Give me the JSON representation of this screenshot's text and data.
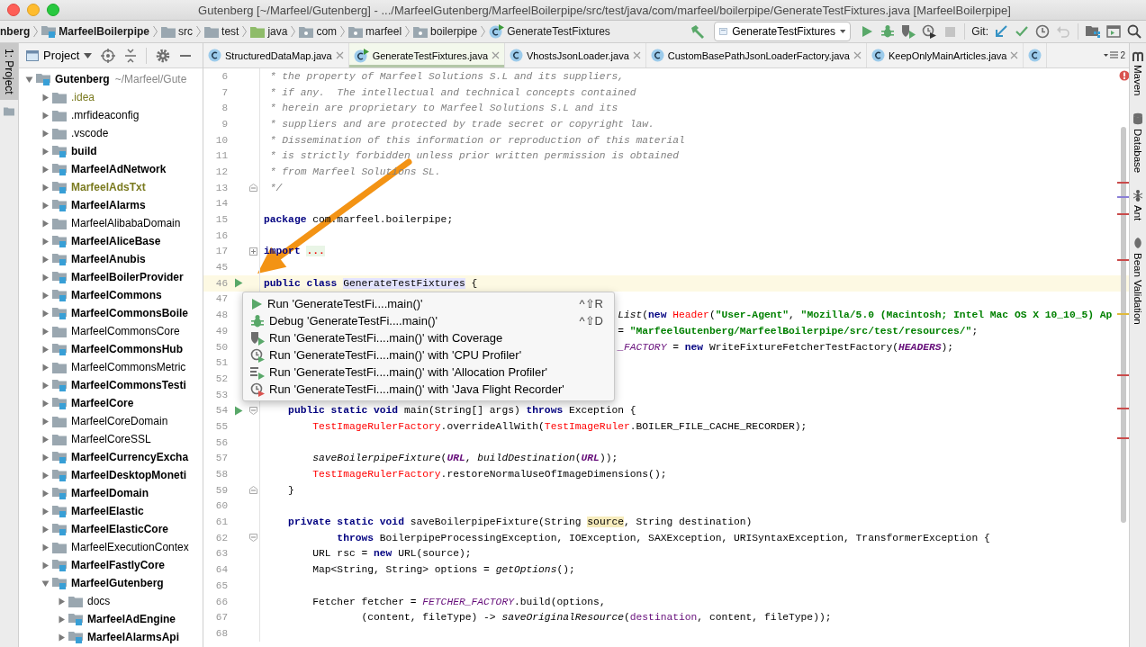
{
  "window": {
    "title": "Gutenberg [~/Marfeel/Gutenberg] - .../MarfeelGutenberg/MarfeelBoilerpipe/src/test/java/com/marfeel/boilerpipe/GenerateTestFixtures.java [MarfeelBoilerpipe]"
  },
  "breadcrumbs": [
    {
      "label": "nberg",
      "kind": "text"
    },
    {
      "label": "MarfeelBoilerpipe",
      "kind": "module"
    },
    {
      "label": "src",
      "kind": "folder"
    },
    {
      "label": "test",
      "kind": "folder"
    },
    {
      "label": "java",
      "kind": "source"
    },
    {
      "label": "com",
      "kind": "package"
    },
    {
      "label": "marfeel",
      "kind": "package"
    },
    {
      "label": "boilerpipe",
      "kind": "package"
    },
    {
      "label": "GenerateTestFixtures",
      "kind": "run-class"
    }
  ],
  "toolbar": {
    "build_buttons": [
      {
        "kind": "build",
        "disabled": false
      }
    ],
    "run_config": "GenerateTestFixtures",
    "run_buttons": [
      {
        "kind": "run",
        "disabled": false
      },
      {
        "kind": "debug",
        "disabled": false
      },
      {
        "kind": "coverage",
        "disabled": false
      },
      {
        "kind": "profile",
        "disabled": false
      },
      {
        "kind": "stop",
        "disabled": true
      }
    ],
    "git_label": "Git:",
    "git_buttons": [
      {
        "kind": "update",
        "disabled": false
      },
      {
        "kind": "commit",
        "disabled": false
      },
      {
        "kind": "history",
        "disabled": false
      },
      {
        "kind": "rollback",
        "disabled": true
      }
    ],
    "tool_buttons": [
      {
        "kind": "structure",
        "disabled": false
      },
      {
        "kind": "terminal",
        "disabled": false
      },
      {
        "kind": "search",
        "disabled": false
      }
    ]
  },
  "left_tools": [
    {
      "label": "1: Project",
      "selected": true
    }
  ],
  "project": {
    "view": "Project",
    "tree": [
      {
        "label": "Gutenberg",
        "hint": "~/Marfeel/Gute",
        "module": true,
        "expanded": true,
        "ignored": false,
        "children": [
          {
            "label": ".idea",
            "module": false,
            "expanded": false,
            "ignored": true
          },
          {
            "label": ".mrfideaconfig",
            "module": false,
            "expanded": false,
            "ignored": false
          },
          {
            "label": ".vscode",
            "module": false,
            "expanded": false,
            "ignored": false
          },
          {
            "label": "build",
            "module": true,
            "expanded": false,
            "ignored": false
          },
          {
            "label": "MarfeelAdNetwork",
            "module": true,
            "expanded": false,
            "ignored": false
          },
          {
            "label": "MarfeelAdsTxt",
            "module": true,
            "expanded": false,
            "ignored": true
          },
          {
            "label": "MarfeelAlarms",
            "module": true,
            "expanded": false,
            "ignored": false
          },
          {
            "label": "MarfeelAlibabaDomain",
            "module": false,
            "expanded": false,
            "ignored": false
          },
          {
            "label": "MarfeelAliceBase",
            "module": true,
            "expanded": false,
            "ignored": false
          },
          {
            "label": "MarfeelAnubis",
            "module": true,
            "expanded": false,
            "ignored": false
          },
          {
            "label": "MarfeelBoilerProvider",
            "module": true,
            "expanded": false,
            "ignored": false
          },
          {
            "label": "MarfeelCommons",
            "module": true,
            "expanded": false,
            "ignored": false
          },
          {
            "label": "MarfeelCommonsBoile",
            "module": true,
            "expanded": false,
            "ignored": false
          },
          {
            "label": "MarfeelCommonsCore",
            "module": false,
            "expanded": false,
            "ignored": false
          },
          {
            "label": "MarfeelCommonsHub",
            "module": true,
            "expanded": false,
            "ignored": false
          },
          {
            "label": "MarfeelCommonsMetric",
            "module": false,
            "expanded": false,
            "ignored": false
          },
          {
            "label": "MarfeelCommonsTesti",
            "module": true,
            "expanded": false,
            "ignored": false
          },
          {
            "label": "MarfeelCore",
            "module": true,
            "expanded": false,
            "ignored": false
          },
          {
            "label": "MarfeelCoreDomain",
            "module": false,
            "expanded": false,
            "ignored": false
          },
          {
            "label": "MarfeelCoreSSL",
            "module": false,
            "expanded": false,
            "ignored": false
          },
          {
            "label": "MarfeelCurrencyExcha",
            "module": true,
            "expanded": false,
            "ignored": false
          },
          {
            "label": "MarfeelDesktopMoneti",
            "module": true,
            "expanded": false,
            "ignored": false
          },
          {
            "label": "MarfeelDomain",
            "module": true,
            "expanded": false,
            "ignored": false
          },
          {
            "label": "MarfeelElastic",
            "module": true,
            "expanded": false,
            "ignored": false
          },
          {
            "label": "MarfeelElasticCore",
            "module": true,
            "expanded": false,
            "ignored": false
          },
          {
            "label": "MarfeelExecutionContex",
            "module": false,
            "expanded": false,
            "ignored": false
          },
          {
            "label": "MarfeelFastlyCore",
            "module": true,
            "expanded": false,
            "ignored": false
          },
          {
            "label": "MarfeelGutenberg",
            "module": true,
            "expanded": true,
            "ignored": false,
            "children": [
              {
                "label": "docs",
                "module": false,
                "expanded": false,
                "ignored": false
              },
              {
                "label": "MarfeelAdEngine",
                "module": true,
                "expanded": false,
                "ignored": false
              },
              {
                "label": "MarfeelAlarmsApi",
                "module": true,
                "expanded": false,
                "ignored": false
              }
            ]
          }
        ]
      }
    ]
  },
  "editor": {
    "tabs": [
      {
        "label": "StructuredDataMap.java",
        "kind": "class",
        "selected": false
      },
      {
        "label": "GenerateTestFixtures.java",
        "kind": "run-class",
        "selected": true
      },
      {
        "label": "VhostsJsonLoader.java",
        "kind": "class",
        "selected": false
      },
      {
        "label": "CustomBasePathJsonLoaderFactory.java",
        "kind": "class",
        "selected": false
      },
      {
        "label": "KeepOnlyMainArticles.java",
        "kind": "class",
        "selected": false
      },
      {
        "kind": "class",
        "selected": false
      }
    ],
    "tab_overflow": "2",
    "lines": [
      {
        "n": "6",
        "kind": "code",
        "current": false,
        "tokens": [
          {
            "kind": "cm",
            "text": " * the property of Marfeel Solutions S.L and its suppliers,"
          }
        ]
      },
      {
        "n": "7",
        "kind": "code",
        "current": false,
        "tokens": [
          {
            "kind": "cm",
            "text": " * if any.  The intellectual and technical concepts contained"
          }
        ]
      },
      {
        "n": "8",
        "kind": "code",
        "current": false,
        "tokens": [
          {
            "kind": "cm",
            "text": " * herein are proprietary to Marfeel Solutions S.L and its"
          }
        ]
      },
      {
        "n": "9",
        "kind": "code",
        "current": false,
        "tokens": [
          {
            "kind": "cm",
            "text": " * suppliers and are protected by trade secret or copyright law."
          }
        ]
      },
      {
        "n": "10",
        "kind": "code",
        "current": false,
        "tokens": [
          {
            "kind": "cm",
            "text": " * Dissemination of this information or reproduction of this material"
          }
        ]
      },
      {
        "n": "11",
        "kind": "code",
        "current": false,
        "tokens": [
          {
            "kind": "cm",
            "text": " * is strictly forbidden unless prior written permission is obtained"
          }
        ]
      },
      {
        "n": "12",
        "kind": "code",
        "current": false,
        "tokens": [
          {
            "kind": "cm",
            "text": " * from Marfeel Solutions SL."
          }
        ]
      },
      {
        "n": "13",
        "kind": "fold-end",
        "current": false,
        "tokens": [
          {
            "kind": "cm",
            "text": " */"
          }
        ]
      },
      {
        "n": "14",
        "kind": "code",
        "current": false
      },
      {
        "n": "15",
        "kind": "code",
        "current": false,
        "tokens": [
          {
            "kind": "kw",
            "text": "package"
          },
          {
            "kind": "plain",
            "text": " com.marfeel.boilerpipe;"
          }
        ]
      },
      {
        "n": "16",
        "kind": "code",
        "current": false
      },
      {
        "n": "17",
        "kind": "fold-collapsed",
        "current": false,
        "tokens": [
          {
            "kind": "kw",
            "text": "import "
          },
          {
            "kind": "folded",
            "text": "..."
          }
        ]
      },
      {
        "n": "45",
        "kind": "code",
        "current": false
      },
      {
        "n": "46",
        "kind": "run",
        "current": true,
        "tokens": [
          {
            "kind": "kw",
            "text": "public class "
          },
          {
            "kind": "decl",
            "text": "GenerateTestFixtures"
          },
          {
            "kind": "plain",
            "text": " {"
          }
        ]
      },
      {
        "n": "47",
        "kind": "code",
        "current": false
      },
      {
        "n": "48",
        "kind": "covered",
        "current": false,
        "tokens": [
          {
            "kind": "call",
            "text": "List"
          },
          {
            "kind": "plain",
            "text": "("
          },
          {
            "kind": "kw",
            "text": "new "
          },
          {
            "kind": "err",
            "text": "Header"
          },
          {
            "kind": "plain",
            "text": "("
          },
          {
            "kind": "str",
            "text": "\"User-Agent\""
          },
          {
            "kind": "plain",
            "text": ", "
          },
          {
            "kind": "str",
            "text": "\"Mozilla/5.0 (Macintosh; Intel Mac OS X 10_10_5) Ap"
          }
        ]
      },
      {
        "n": "49",
        "kind": "covered",
        "current": false,
        "tokens": [
          {
            "kind": "plain",
            "text": "= "
          },
          {
            "kind": "str",
            "text": "\"MarfeelGutenberg/MarfeelBoilerpipe/src/test/resources/\""
          },
          {
            "kind": "plain",
            "text": ";"
          }
        ]
      },
      {
        "n": "50",
        "kind": "covered",
        "current": false,
        "tokens": [
          {
            "kind": "static",
            "text": "_FACTORY"
          },
          {
            "kind": "plain",
            "text": " = "
          },
          {
            "kind": "kw",
            "text": "new"
          },
          {
            "kind": "plain",
            "text": " WriteFixtureFetcherTestFactory("
          },
          {
            "kind": "const",
            "text": "HEADERS"
          },
          {
            "kind": "plain",
            "text": ");"
          }
        ]
      },
      {
        "n": "51",
        "kind": "code",
        "current": false
      },
      {
        "n": "52",
        "kind": "code",
        "current": false
      },
      {
        "n": "53",
        "kind": "code",
        "current": false
      },
      {
        "n": "54",
        "kind": "run-fold-start",
        "current": false,
        "tokens": [
          {
            "kind": "kw",
            "text": "    public static void"
          },
          {
            "kind": "plain",
            "text": " main(String[] args) "
          },
          {
            "kind": "kw",
            "text": "throws"
          },
          {
            "kind": "plain",
            "text": " Exception {"
          }
        ]
      },
      {
        "n": "55",
        "kind": "code",
        "current": false,
        "tokens": [
          {
            "kind": "err",
            "text": "        TestImageRulerFactory"
          },
          {
            "kind": "plain",
            "text": ".overrideAllWith("
          },
          {
            "kind": "err",
            "text": "TestImageRuler"
          },
          {
            "kind": "plain",
            "text": ".BOILER_FILE_CACHE_RECORDER);"
          }
        ]
      },
      {
        "n": "56",
        "kind": "code",
        "current": false
      },
      {
        "n": "57",
        "kind": "code",
        "current": false,
        "tokens": [
          {
            "kind": "call",
            "text": "        saveBoilerpipeFixture"
          },
          {
            "kind": "plain",
            "text": "("
          },
          {
            "kind": "const",
            "text": "URL"
          },
          {
            "kind": "plain",
            "text": ", "
          },
          {
            "kind": "call",
            "text": "buildDestination"
          },
          {
            "kind": "plain",
            "text": "("
          },
          {
            "kind": "const",
            "text": "URL"
          },
          {
            "kind": "plain",
            "text": "));"
          }
        ]
      },
      {
        "n": "58",
        "kind": "code",
        "current": false,
        "tokens": [
          {
            "kind": "err",
            "text": "        TestImageRulerFactory"
          },
          {
            "kind": "plain",
            "text": ".restoreNormalUseOfImageDimensions();"
          }
        ]
      },
      {
        "n": "59",
        "kind": "fold-end",
        "current": false,
        "tokens": [
          {
            "kind": "plain",
            "text": "    }"
          }
        ]
      },
      {
        "n": "60",
        "kind": "code",
        "current": false
      },
      {
        "n": "61",
        "kind": "code",
        "current": false,
        "tokens": [
          {
            "kind": "kw",
            "text": "    private static void"
          },
          {
            "kind": "plain",
            "text": " saveBoilerpipeFixture(String "
          },
          {
            "kind": "hl",
            "text": "source"
          },
          {
            "kind": "plain",
            "text": ", String destination)"
          }
        ]
      },
      {
        "n": "62",
        "kind": "fold-start",
        "current": false,
        "tokens": [
          {
            "kind": "kw",
            "text": "            throws"
          },
          {
            "kind": "plain",
            "text": " BoilerpipeProcessingException, IOException, SAXException, URISyntaxException, TransformerException {"
          }
        ]
      },
      {
        "n": "63",
        "kind": "code",
        "current": false,
        "tokens": [
          {
            "kind": "plain",
            "text": "        URL rsc = "
          },
          {
            "kind": "kw",
            "text": "new"
          },
          {
            "kind": "plain",
            "text": " URL(source);"
          }
        ]
      },
      {
        "n": "64",
        "kind": "code",
        "current": false,
        "tokens": [
          {
            "kind": "plain",
            "text": "        Map<String, String> options = "
          },
          {
            "kind": "call",
            "text": "getOptions"
          },
          {
            "kind": "plain",
            "text": "();"
          }
        ]
      },
      {
        "n": "65",
        "kind": "code",
        "current": false
      },
      {
        "n": "66",
        "kind": "code",
        "current": false,
        "tokens": [
          {
            "kind": "plain",
            "text": "        Fetcher fetcher = "
          },
          {
            "kind": "static",
            "text": "FETCHER_FACTORY"
          },
          {
            "kind": "plain",
            "text": ".build(options,"
          }
        ]
      },
      {
        "n": "67",
        "kind": "code",
        "current": false,
        "tokens": [
          {
            "kind": "plain",
            "text": "                (content, fileType) -> "
          },
          {
            "kind": "call",
            "text": "saveOriginalResource"
          },
          {
            "kind": "plain",
            "text": "("
          },
          {
            "kind": "param",
            "text": "destination"
          },
          {
            "kind": "plain",
            "text": ", content, fileType));"
          }
        ]
      },
      {
        "n": "68",
        "kind": "code",
        "current": false
      }
    ],
    "run_menu": [
      {
        "kind": "run",
        "label": "Run 'GenerateTestFi....main()'",
        "shortcut": "^⇧R"
      },
      {
        "kind": "debug",
        "label": "Debug 'GenerateTestFi....main()'",
        "shortcut": "^⇧D"
      },
      {
        "kind": "coverage",
        "label": "Run 'GenerateTestFi....main()' with Coverage"
      },
      {
        "kind": "cpu",
        "label": "Run 'GenerateTestFi....main()' with 'CPU Profiler'"
      },
      {
        "kind": "alloc",
        "label": "Run 'GenerateTestFi....main()' with 'Allocation Profiler'"
      },
      {
        "kind": "jfr",
        "label": "Run 'GenerateTestFi....main()' with 'Java Flight Recorder'"
      }
    ]
  },
  "right_tools": [
    {
      "label": "Maven",
      "kind": "maven"
    },
    {
      "label": "Database",
      "kind": "database"
    },
    {
      "label": "Ant",
      "kind": "ant"
    },
    {
      "label": "Bean Validation",
      "kind": "bean"
    }
  ]
}
